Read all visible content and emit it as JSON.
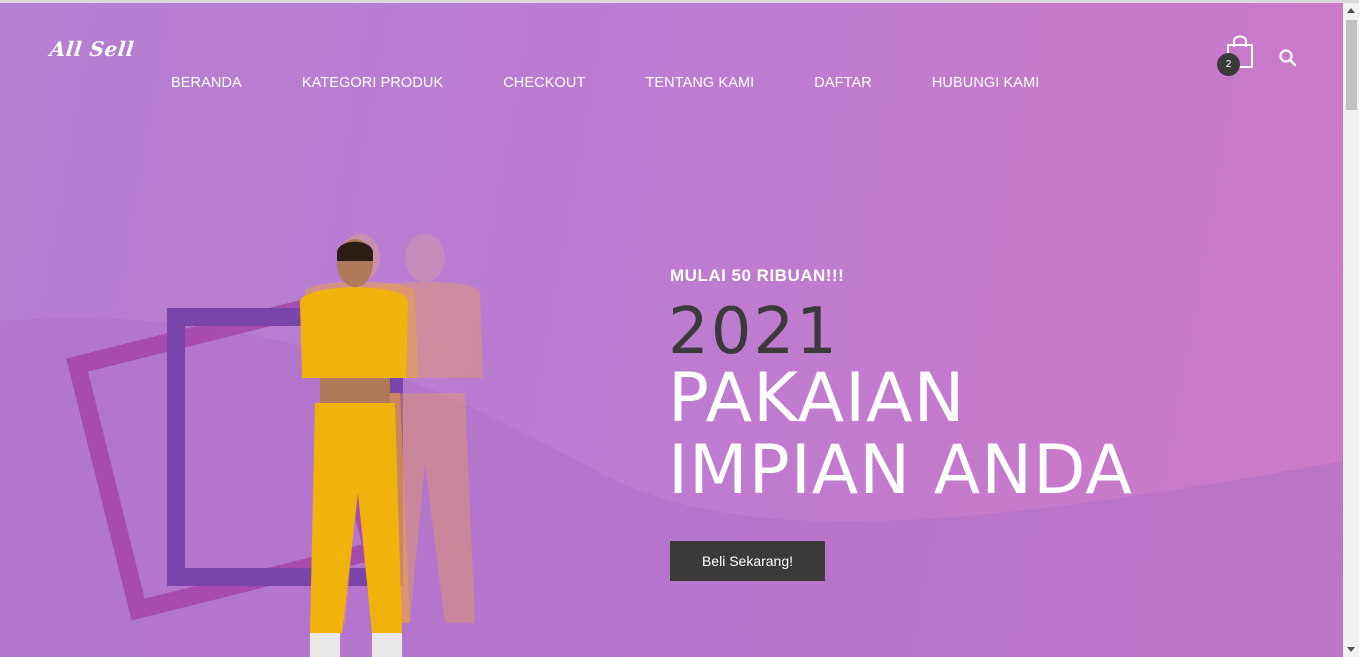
{
  "brand": {
    "logo_text": "All Sell"
  },
  "nav": {
    "items": [
      {
        "label": "BERANDA"
      },
      {
        "label": "KATEGORI PRODUK"
      },
      {
        "label": "CHECKOUT"
      },
      {
        "label": "TENTANG KAMI"
      },
      {
        "label": "DAFTAR"
      },
      {
        "label": "HUBUNGI KAMI"
      }
    ]
  },
  "header_icons": {
    "cart_icon": "shopping-bag-icon",
    "cart_count": "2",
    "search_icon": "search-icon"
  },
  "hero": {
    "subtitle": "MULAI 50 RIBUAN!!!",
    "year": "2021",
    "headline_line1": "PAKAIAN",
    "headline_line2": "IMPIAN ANDA",
    "cta_label": "Beli Sekarang!"
  },
  "colors": {
    "hero_bg": "#bb7cd3",
    "dark_text": "#3a3a3a",
    "frame_purple": "#7a45a8",
    "frame_pink": "#a545a8",
    "outfit_yellow": "#f2b20c"
  }
}
